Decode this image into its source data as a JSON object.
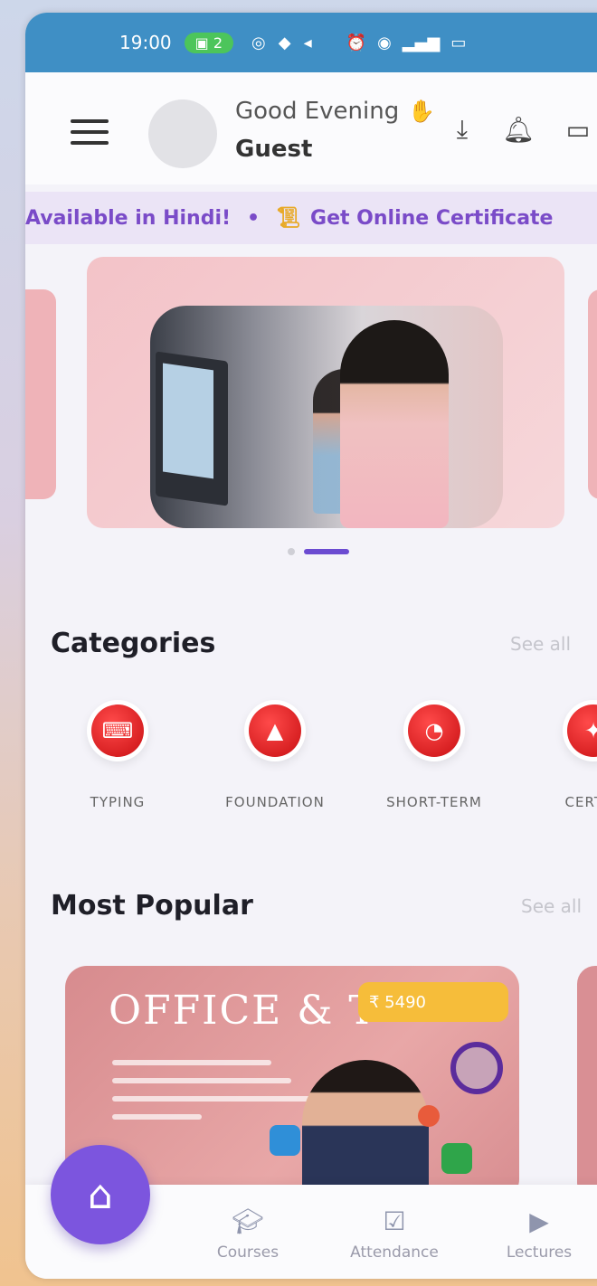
{
  "status_bar": {
    "time": "19:00",
    "pill": "2"
  },
  "header": {
    "greeting": "Good Evening",
    "wave_icon": "wave-icon",
    "user_name": "Guest"
  },
  "ticker": {
    "items": [
      "Available in Hindi!",
      "Get Online Certificate"
    ]
  },
  "carousel": {
    "slides": 3,
    "active_index": 1
  },
  "categories": {
    "title": "Categories",
    "see_all": "See all",
    "items": [
      {
        "label": "TYPING",
        "icon": "keyboard-icon"
      },
      {
        "label": "FOUNDATION",
        "icon": "foundation-icon"
      },
      {
        "label": "SHORT-TERM",
        "icon": "clock-icon"
      },
      {
        "label": "CERTIFI",
        "icon": "certificate-icon"
      }
    ]
  },
  "most_popular": {
    "title": "Most Popular",
    "see_all": "See all",
    "cards": [
      {
        "title": "OFFICE & T",
        "price": "₹ 5490"
      }
    ]
  },
  "bottom_nav": {
    "home_icon": "home-icon",
    "items": [
      {
        "label": "Courses",
        "icon": "graduation-cap-icon"
      },
      {
        "label": "Attendance",
        "icon": "clipboard-check-icon"
      },
      {
        "label": "Lectures",
        "icon": "play-circle-icon"
      }
    ]
  },
  "colors": {
    "accent": "#7c55de",
    "category_red": "#d21418",
    "status_bar": "#3f8fc5"
  }
}
